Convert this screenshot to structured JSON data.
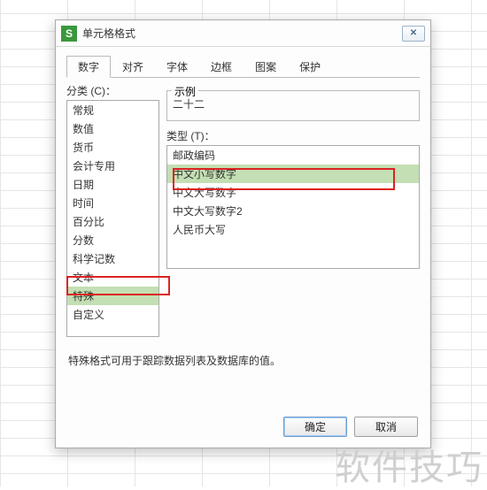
{
  "dialog": {
    "title": "单元格格式",
    "app_icon_letter": "S"
  },
  "tabs": [
    "数字",
    "对齐",
    "字体",
    "边框",
    "图案",
    "保护"
  ],
  "active_tab_index": 0,
  "left": {
    "label": "分类 (C)：",
    "items": [
      "常规",
      "数值",
      "货币",
      "会计专用",
      "日期",
      "时间",
      "百分比",
      "分数",
      "科学记数",
      "文本",
      "特殊",
      "自定义"
    ],
    "selected_index": 10
  },
  "right": {
    "example_label": "示例",
    "example_value": "二十二",
    "type_label": "类型 (T)：",
    "type_items": [
      "邮政编码",
      "中文小写数字",
      "中文大写数字",
      "中文大写数字2",
      "人民币大写"
    ],
    "type_selected_index": 1
  },
  "description": "特殊格式可用于跟踪数据列表及数据库的值。",
  "buttons": {
    "ok": "确定",
    "cancel": "取消"
  },
  "watermark": "软件技巧"
}
